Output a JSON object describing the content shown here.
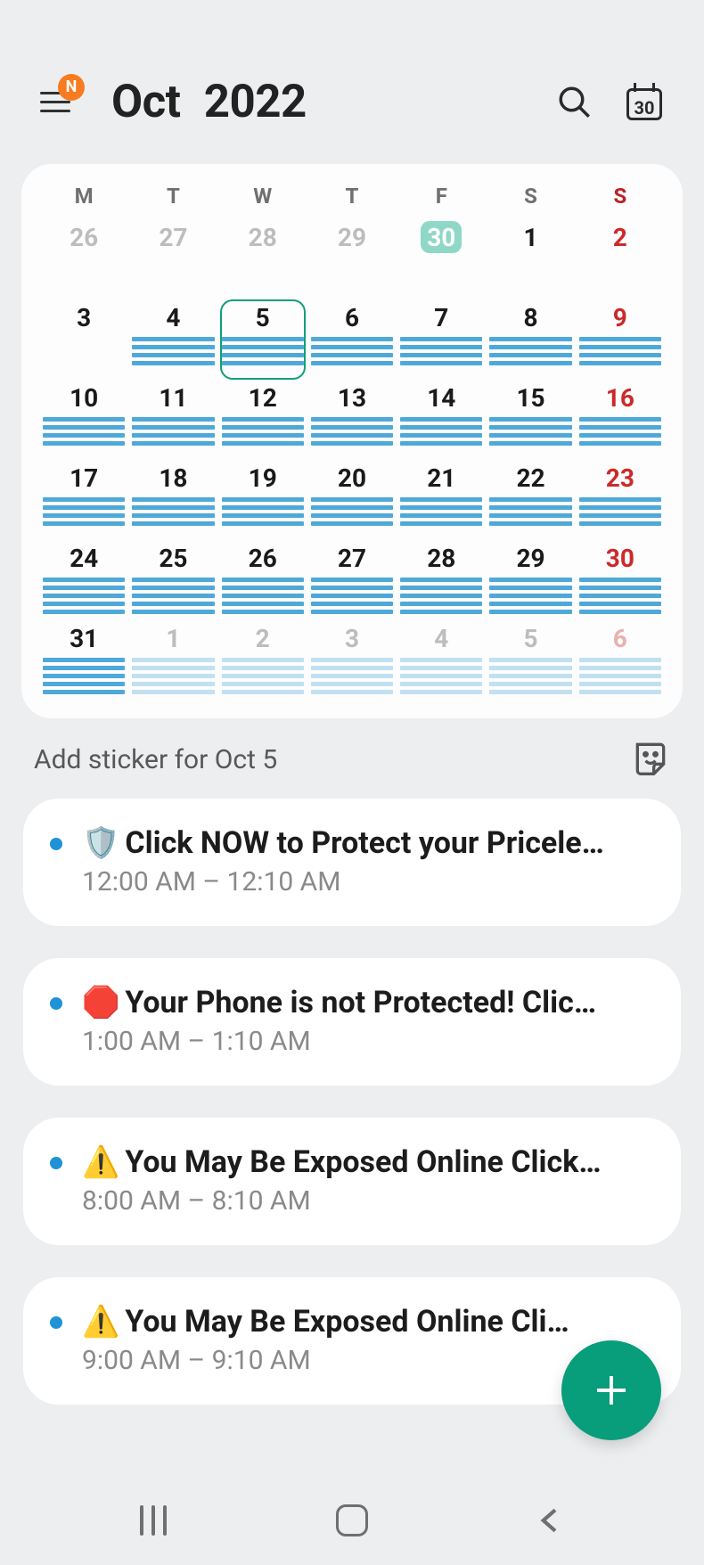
{
  "header": {
    "badge": "N",
    "month": "Oct",
    "year": "2022",
    "today_icon_day": "30"
  },
  "calendar": {
    "dow": [
      "M",
      "T",
      "W",
      "T",
      "F",
      "S",
      "S"
    ],
    "weeks": [
      [
        {
          "n": "26",
          "other": true
        },
        {
          "n": "27",
          "other": true
        },
        {
          "n": "28",
          "other": true
        },
        {
          "n": "29",
          "other": true
        },
        {
          "n": "30",
          "other": true,
          "today": true
        },
        {
          "n": "1"
        },
        {
          "n": "2",
          "sun": true
        }
      ],
      [
        {
          "n": "3"
        },
        {
          "n": "4",
          "bars": 4
        },
        {
          "n": "5",
          "bars": 4,
          "selected": true
        },
        {
          "n": "6",
          "bars": 4
        },
        {
          "n": "7",
          "bars": 4
        },
        {
          "n": "8",
          "bars": 4
        },
        {
          "n": "9",
          "sun": true,
          "bars": 4
        }
      ],
      [
        {
          "n": "10",
          "bars": 4
        },
        {
          "n": "11",
          "bars": 4
        },
        {
          "n": "12",
          "bars": 4
        },
        {
          "n": "13",
          "bars": 4
        },
        {
          "n": "14",
          "bars": 4
        },
        {
          "n": "15",
          "bars": 4
        },
        {
          "n": "16",
          "sun": true,
          "bars": 4
        }
      ],
      [
        {
          "n": "17",
          "bars": 4
        },
        {
          "n": "18",
          "bars": 4
        },
        {
          "n": "19",
          "bars": 4
        },
        {
          "n": "20",
          "bars": 4
        },
        {
          "n": "21",
          "bars": 4
        },
        {
          "n": "22",
          "bars": 4
        },
        {
          "n": "23",
          "sun": true,
          "bars": 4
        }
      ],
      [
        {
          "n": "24",
          "bars": 5
        },
        {
          "n": "25",
          "bars": 5
        },
        {
          "n": "26",
          "bars": 5
        },
        {
          "n": "27",
          "bars": 5
        },
        {
          "n": "28",
          "bars": 5
        },
        {
          "n": "29",
          "bars": 5
        },
        {
          "n": "30",
          "sun": true,
          "bars": 5
        }
      ],
      [
        {
          "n": "31",
          "bars": 5
        },
        {
          "n": "1",
          "other": true,
          "bars": 5,
          "faded": true
        },
        {
          "n": "2",
          "other": true,
          "bars": 5,
          "faded": true
        },
        {
          "n": "3",
          "other": true,
          "bars": 5,
          "faded": true
        },
        {
          "n": "4",
          "other": true,
          "bars": 5,
          "faded": true
        },
        {
          "n": "5",
          "other": true,
          "bars": 5,
          "faded": true
        },
        {
          "n": "6",
          "other": true,
          "sun": true,
          "bars": 5,
          "faded": true
        }
      ]
    ]
  },
  "sticker_label": "Add sticker for Oct 5",
  "events": [
    {
      "emoji": "🛡️",
      "title": "Click NOW to Protect your Pricele…",
      "time": "12:00 AM – 12:10 AM"
    },
    {
      "emoji": "🛑",
      "title": "Your Phone is not Protected! Clic…",
      "time": "1:00 AM – 1:10 AM"
    },
    {
      "emoji": "⚠️",
      "title": "You May Be Exposed Online  Click…",
      "time": "8:00 AM – 8:10 AM"
    },
    {
      "emoji": "⚠️",
      "title": "You May Be Exposed Online  Cli…",
      "time": "9:00 AM – 9:10 AM"
    }
  ]
}
